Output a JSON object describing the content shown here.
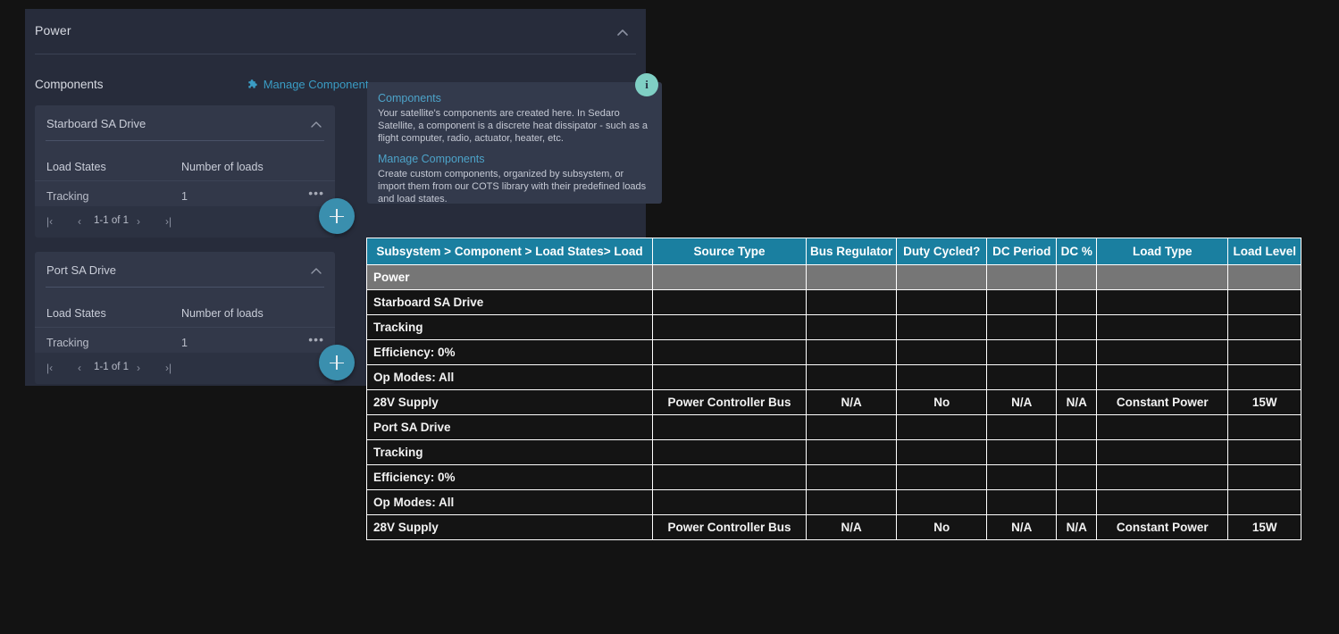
{
  "panel": {
    "title": "Power",
    "collapse_icon": "chevron-up-icon",
    "components_label": "Components",
    "manage_components_label": "Manage Components",
    "manage_components_icon": "puzzle-piece-icon",
    "accent_color": "#3a9cc4",
    "background_color": "#272c3b",
    "card_color": "#323849"
  },
  "cards": [
    {
      "title": "Starboard SA Drive",
      "collapse_icon": "chevron-up-icon",
      "col_headers": [
        "Load States",
        "Number of loads"
      ],
      "rows": [
        {
          "load_state": "Tracking",
          "number_of_loads": "1",
          "menu_icon": "ellipsis-icon"
        }
      ],
      "pager": {
        "first": "|‹",
        "prev": "‹",
        "label": "1-1 of 1",
        "next": "›",
        "last": "›|"
      },
      "add_button_icon": "plus-icon"
    },
    {
      "title": "Port SA Drive",
      "collapse_icon": "chevron-up-icon",
      "col_headers": [
        "Load States",
        "Number of loads"
      ],
      "rows": [
        {
          "load_state": "Tracking",
          "number_of_loads": "1",
          "menu_icon": "ellipsis-icon"
        }
      ],
      "pager": {
        "first": "|‹",
        "prev": "‹",
        "label": "1-1 of 1",
        "next": "›",
        "last": "›|"
      },
      "add_button_icon": "plus-icon"
    }
  ],
  "tooltip": {
    "icon": "info-icon",
    "icon_glyph": "i",
    "icon_color": "#7fcfc4",
    "sections": [
      {
        "heading": "Components",
        "body": "Your satellite's components are created here. In Sedaro Satellite, a component is a discrete heat dissipator - such as a flight computer, radio, actuator, heater, etc."
      },
      {
        "heading": "Manage Components",
        "body": "Create custom components, organized by subsystem, or import them from our COTS library with their predefined loads and load states."
      }
    ]
  },
  "table": {
    "header_color": "#1a7fa0",
    "section_row_color": "#767676",
    "columns": [
      "Subsystem > Component > Load States> Load",
      "Source Type",
      "Bus Regulator",
      "Duty Cycled?",
      "DC Period",
      "DC %",
      "Load Type",
      "Load Level"
    ],
    "rows": [
      {
        "kind": "section",
        "cells": [
          "Power",
          "",
          "",
          "",
          "",
          "",
          "",
          ""
        ]
      },
      {
        "kind": "data",
        "cells": [
          "Starboard SA Drive",
          "",
          "",
          "",
          "",
          "",
          "",
          ""
        ]
      },
      {
        "kind": "data",
        "cells": [
          "Tracking",
          "",
          "",
          "",
          "",
          "",
          "",
          ""
        ]
      },
      {
        "kind": "data",
        "cells": [
          "Efficiency: 0%",
          "",
          "",
          "",
          "",
          "",
          "",
          ""
        ]
      },
      {
        "kind": "data",
        "cells": [
          "Op Modes: All",
          "",
          "",
          "",
          "",
          "",
          "",
          ""
        ]
      },
      {
        "kind": "data",
        "cells": [
          "28V Supply",
          "Power Controller Bus",
          "N/A",
          "No",
          "N/A",
          "N/A",
          "Constant Power",
          "15W"
        ]
      },
      {
        "kind": "data",
        "cells": [
          "Port SA Drive",
          "",
          "",
          "",
          "",
          "",
          "",
          ""
        ]
      },
      {
        "kind": "data",
        "cells": [
          "Tracking",
          "",
          "",
          "",
          "",
          "",
          "",
          ""
        ]
      },
      {
        "kind": "data",
        "cells": [
          "Efficiency: 0%",
          "",
          "",
          "",
          "",
          "",
          "",
          ""
        ]
      },
      {
        "kind": "data",
        "cells": [
          "Op Modes: All",
          "",
          "",
          "",
          "",
          "",
          "",
          ""
        ]
      },
      {
        "kind": "data",
        "cells": [
          "28V Supply",
          "Power Controller Bus",
          "N/A",
          "No",
          "N/A",
          "N/A",
          "Constant Power",
          "15W"
        ]
      }
    ]
  }
}
